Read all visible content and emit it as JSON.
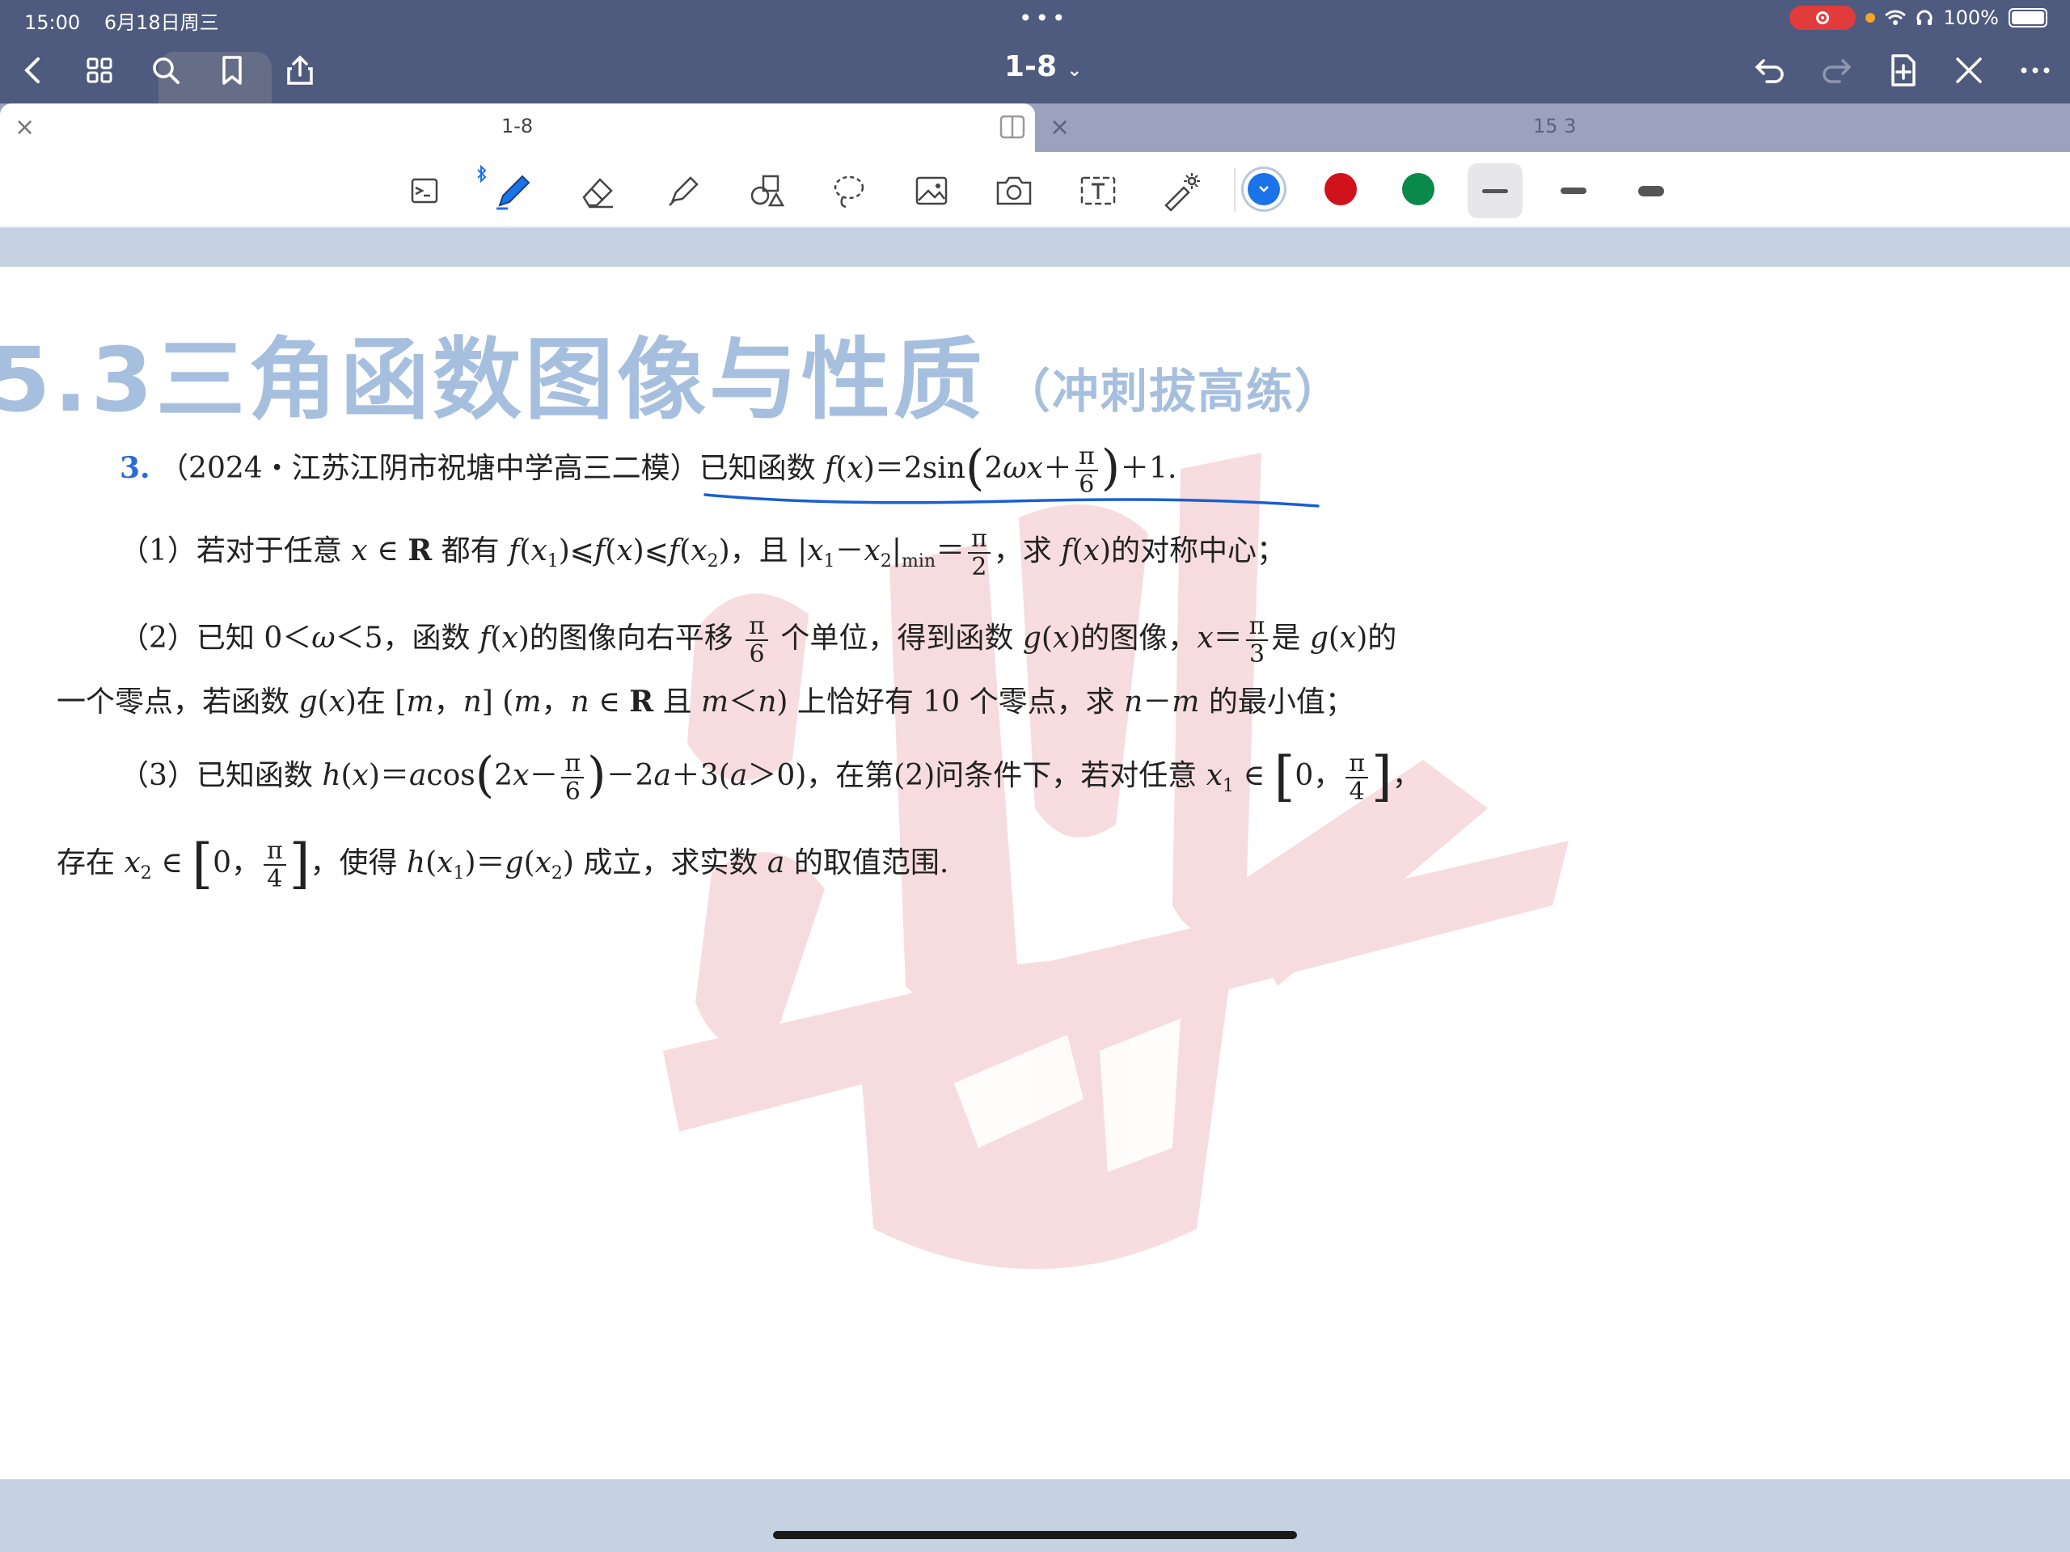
{
  "status": {
    "time": "15:00",
    "date": "6月18日周三",
    "battery": "100%"
  },
  "nav": {
    "title": "1-8"
  },
  "tabs": [
    {
      "label": "1-8",
      "active": true
    },
    {
      "label": "15 3",
      "active": false
    }
  ],
  "colors": {
    "blue": "#1a73e8",
    "red": "#d0121b",
    "green": "#0a8a4a",
    "accent": "#2b6bd6",
    "heading": "#a7bfde"
  },
  "doc": {
    "title": "5.3三角函数图像与性质",
    "subtitle": "（冲刺拔高练）",
    "problem_number": "3.",
    "source": "（2024・江苏江阴市祝塘中学高三二模）",
    "intro": "已知函数",
    "part1": {
      "a": "（1）若对于任意",
      "b": "都有",
      "c": "，且",
      "d": "，求",
      "e": "的对称中心；"
    },
    "part2": {
      "line1_a": "（2）已知",
      "line1_b": "，函数",
      "line1_c": "的图像向右平移",
      "line1_d": "个单位，得到函数",
      "line1_e": "的图像，",
      "line1_f": "是",
      "line1_g": "的",
      "line2_a": "一个零点，若函数",
      "line2_b": "在",
      "line2_c": "上恰好有 10 个零点，求",
      "line2_d": "的最小值；"
    },
    "part3": {
      "line1_a": "（3）已知函数",
      "line1_b": "，在第(2)问条件下，若对任意",
      "line2_a": "存在",
      "line2_b": "，使得",
      "line2_c": "成立，求实数",
      "line2_d": "的取值范围."
    }
  }
}
